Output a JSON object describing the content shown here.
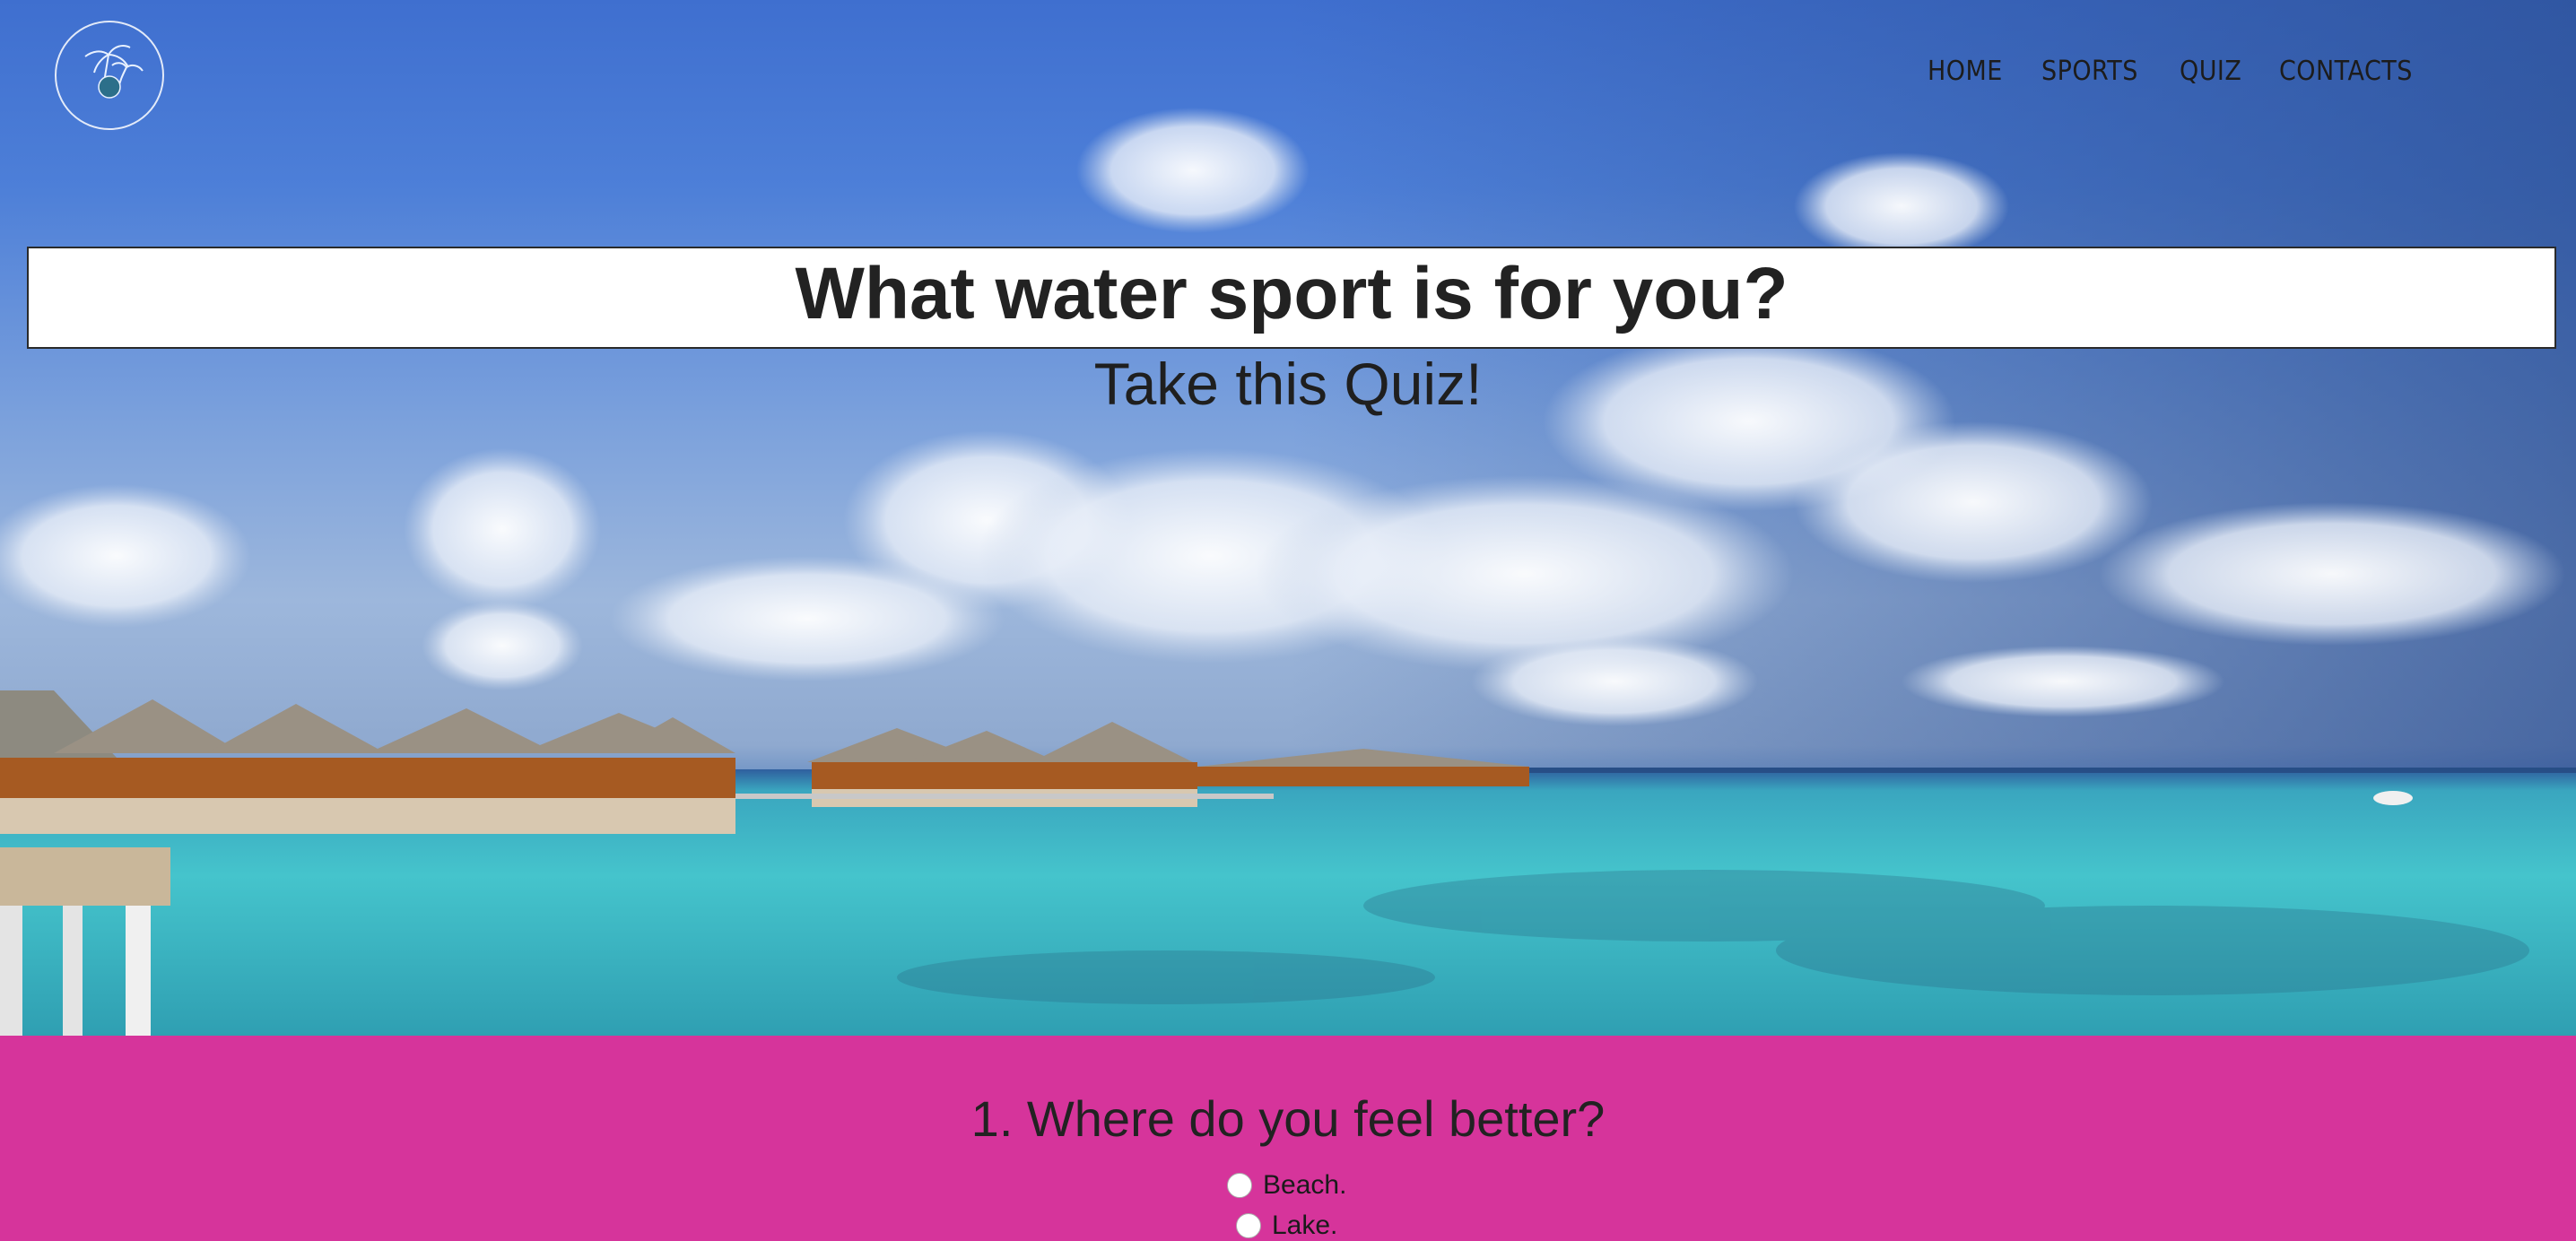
{
  "nav": {
    "items": [
      {
        "label": "HOME"
      },
      {
        "label": "SPORTS"
      },
      {
        "label": "QUIZ"
      },
      {
        "label": "CONTACTS"
      }
    ]
  },
  "hero": {
    "title": "What water sport is for you?",
    "subtitle": "Take this Quiz!"
  },
  "quiz": {
    "question": "1. Where do you feel better?",
    "options": [
      {
        "label": "Beach."
      },
      {
        "label": "Lake."
      }
    ]
  },
  "colors": {
    "quiz_background": "#d6349b",
    "title_box": "#ffffff",
    "sky": "#4d7fd8",
    "water": "#46c3c9"
  },
  "icons": {
    "logo": "palm-tree-logo-icon"
  }
}
